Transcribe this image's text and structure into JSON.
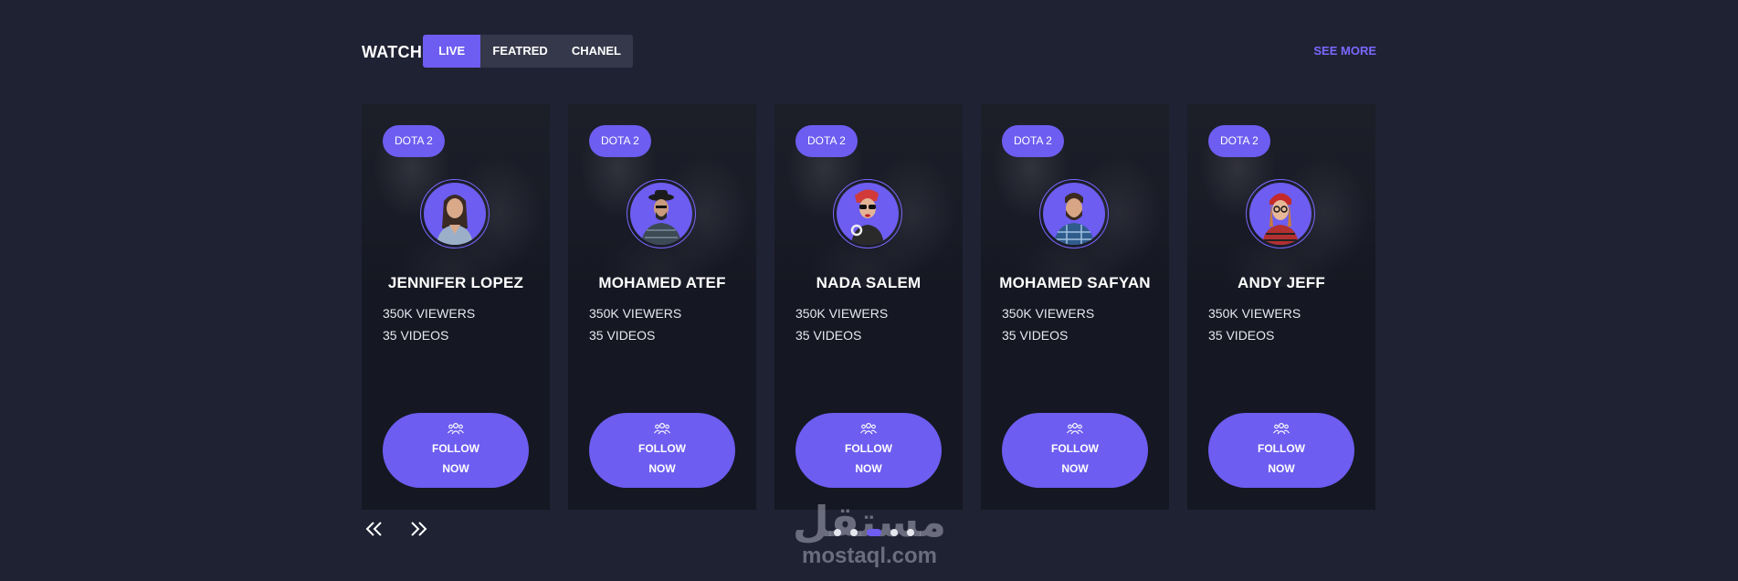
{
  "header": {
    "title": "WATCH",
    "tabs": [
      "LIVE",
      "FEATRED",
      "CHANEL"
    ],
    "active_tab": "LIVE",
    "see_more": "SEE MORE"
  },
  "cards": [
    {
      "badge": "DOTA 2",
      "name": "JENNIFER LOPEZ",
      "viewers": "350K VIEWERS",
      "videos": "35 VIDEOS",
      "follow": "FOLLOW NOW"
    },
    {
      "badge": "DOTA 2",
      "name": "MOHAMED ATEF",
      "viewers": "350K VIEWERS",
      "videos": "35 VIDEOS",
      "follow": "FOLLOW NOW"
    },
    {
      "badge": "DOTA 2",
      "name": "NADA SALEM",
      "viewers": "350K VIEWERS",
      "videos": "35 VIDEOS",
      "follow": "FOLLOW NOW"
    },
    {
      "badge": "DOTA 2",
      "name": "MOHAMED SAFYAN",
      "viewers": "350K VIEWERS",
      "videos": "35 VIDEOS",
      "follow": "FOLLOW NOW"
    },
    {
      "badge": "DOTA 2",
      "name": "ANDY JEFF",
      "viewers": "350K VIEWERS",
      "videos": "35 VIDEOS",
      "follow": "FOLLOW NOW"
    }
  ],
  "carousel": {
    "prev_icon": "double-chevron-left-icon",
    "next_icon": "double-chevron-right-icon",
    "page_count": 5,
    "active_page": 2
  },
  "watermark": {
    "arabic": "مستقل",
    "latin": "mostaql.com"
  },
  "colors": {
    "background": "#1f2233",
    "card": "#151722",
    "accent": "#6d5df0",
    "link": "#7a68ff",
    "tab_bar": "#35384a"
  }
}
